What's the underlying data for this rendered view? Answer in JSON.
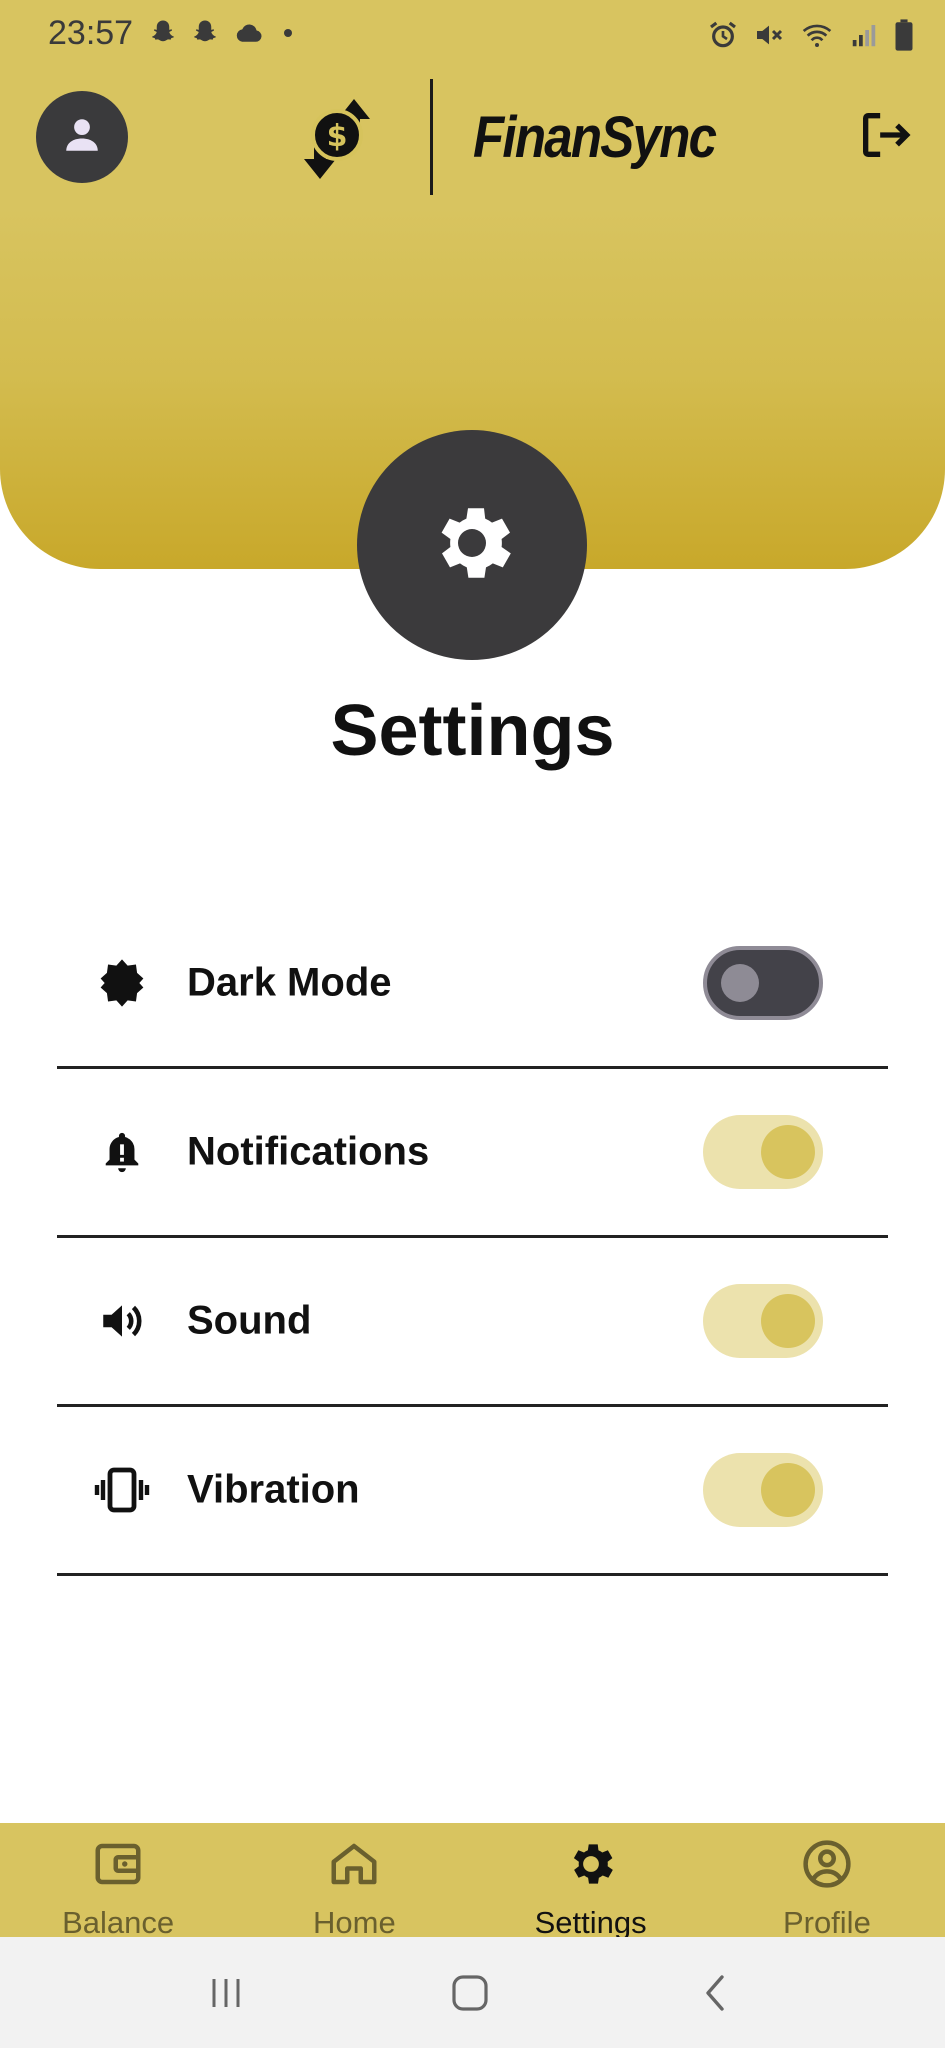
{
  "status_bar": {
    "time": "23:57",
    "left_icons": [
      "snapchat-icon",
      "snapchat-icon",
      "cloud-icon",
      "dot-icon"
    ],
    "right_icons": [
      "alarm-icon",
      "mute-icon",
      "wifi-icon",
      "signal-icon",
      "battery-icon"
    ]
  },
  "header": {
    "app_name": "FinanSync",
    "logo_icon": "dollar-exchange-icon",
    "avatar_icon": "user-icon",
    "logout_icon": "logout-icon",
    "colors": {
      "top": "#d8c460",
      "bottom": "#c8a82a"
    }
  },
  "page": {
    "badge_icon": "gear-icon",
    "title": "Settings"
  },
  "settings": [
    {
      "icon": "brightness-icon",
      "label": "Dark Mode",
      "enabled": false
    },
    {
      "icon": "bell-alert-icon",
      "label": "Notifications",
      "enabled": true
    },
    {
      "icon": "speaker-icon",
      "label": "Sound",
      "enabled": true
    },
    {
      "icon": "vibration-icon",
      "label": "Vibration",
      "enabled": true
    }
  ],
  "bottom_nav": {
    "items": [
      {
        "icon": "wallet-icon",
        "label": "Balance",
        "active": false
      },
      {
        "icon": "home-icon",
        "label": "Home",
        "active": false
      },
      {
        "icon": "gear-icon",
        "label": "Settings",
        "active": true
      },
      {
        "icon": "profile-icon",
        "label": "Profile",
        "active": false
      }
    ],
    "background": "#d8c460"
  },
  "system_nav": [
    "recents-button",
    "home-button",
    "back-button"
  ]
}
